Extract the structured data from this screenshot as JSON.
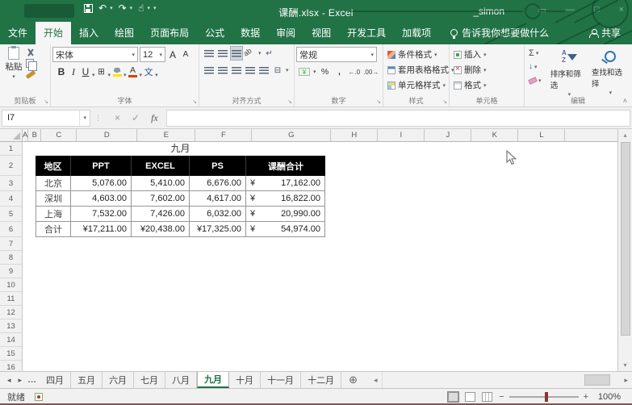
{
  "icons": {
    "dropdown": "▾",
    "undo": "↶",
    "redo": "↷",
    "touch": "☝",
    "qat_more": "▾",
    "win_min": "—",
    "win_max": "□",
    "win_ribbon": "▭",
    "close_x": "×",
    "check": "✓",
    "fx": "fx",
    "sum": "Σ",
    "fill_down": "↓",
    "grid_border": "⊞",
    "wen": "文",
    "bold": "B",
    "italic": "I",
    "underline": "U",
    "font_grow": "A",
    "font_shrink": "A",
    "font_color": "A",
    "percent": "%",
    "comma": ",",
    "inc_decimal": "←.0",
    "dec_decimal": ".00→",
    "wrap": "↵",
    "merge": "⊟",
    "orient": "ab",
    "money": "¥",
    "sort_a": "A",
    "sort_z": "Z",
    "nav_left": "◂",
    "nav_right": "▸",
    "more_tabs": "…",
    "add_sheet": "⊕",
    "scroll_up": "▴",
    "scroll_down": "▾",
    "scroll_left": "◂",
    "scroll_right": "▸",
    "zoom_minus": "−",
    "zoom_plus": "+",
    "collapse": "˄",
    "launcher": "↘",
    "dots": "⋮"
  },
  "titlebar": {
    "title": "课酬.xlsx - Excel",
    "user": "_simon"
  },
  "ribbon": {
    "tabs": [
      "文件",
      "开始",
      "插入",
      "绘图",
      "页面布局",
      "公式",
      "数据",
      "审阅",
      "视图",
      "开发工具",
      "加载项"
    ],
    "active_tab": "开始",
    "tell_me": "告诉我你想要做什么",
    "share": "共享",
    "clipboard": {
      "paste": "粘贴",
      "label": "剪贴板"
    },
    "font": {
      "family": "宋体",
      "size": "12",
      "label": "字体"
    },
    "alignment": {
      "label": "对齐方式"
    },
    "number": {
      "format": "常规",
      "label": "数字"
    },
    "styles": {
      "items": [
        "条件格式",
        "套用表格格式",
        "单元格样式"
      ],
      "label": "样式"
    },
    "cells": {
      "items": [
        "插入",
        "删除",
        "格式"
      ],
      "label": "单元格"
    },
    "editing": {
      "sort": "排序和筛选",
      "find": "查找和选择",
      "label": "编辑"
    }
  },
  "formula_bar": {
    "name_box": "I7",
    "formula": ""
  },
  "sheet": {
    "columns": [
      "A",
      "B",
      "C",
      "D",
      "E",
      "F",
      "G",
      "H",
      "I",
      "J",
      "K",
      "L"
    ],
    "row_numbers": [
      1,
      2,
      3,
      4,
      5,
      6,
      7,
      8,
      9,
      10,
      11,
      12,
      13,
      14,
      15,
      16
    ],
    "table": {
      "title": "九月",
      "headers": [
        "地区",
        "PPT",
        "EXCEL",
        "PS",
        "课酬合计"
      ],
      "rows": [
        {
          "region": "北京",
          "ppt": "5,076.00",
          "excel": "5,410.00",
          "ps": "6,676.00",
          "cur": "¥",
          "total": "17,162.00"
        },
        {
          "region": "深圳",
          "ppt": "4,603.00",
          "excel": "7,602.00",
          "ps": "4,617.00",
          "cur": "¥",
          "total": "16,822.00"
        },
        {
          "region": "上海",
          "ppt": "7,532.00",
          "excel": "7,426.00",
          "ps": "6,032.00",
          "cur": "¥",
          "total": "20,990.00"
        },
        {
          "region": "合计",
          "ppt": "¥17,211.00",
          "excel": "¥20,438.00",
          "ps": "¥17,325.00",
          "cur": "¥",
          "total": "54,974.00"
        }
      ]
    }
  },
  "sheet_tabs": {
    "items": [
      "四月",
      "五月",
      "六月",
      "七月",
      "八月",
      "九月",
      "十月",
      "十一月",
      "十二月"
    ],
    "active": "九月"
  },
  "status_bar": {
    "ready": "就绪",
    "zoom": "100%"
  },
  "colors": {
    "excel_green": "#217346",
    "table_header_fill": "#000000",
    "zoom_thumb": "#8b3333"
  }
}
